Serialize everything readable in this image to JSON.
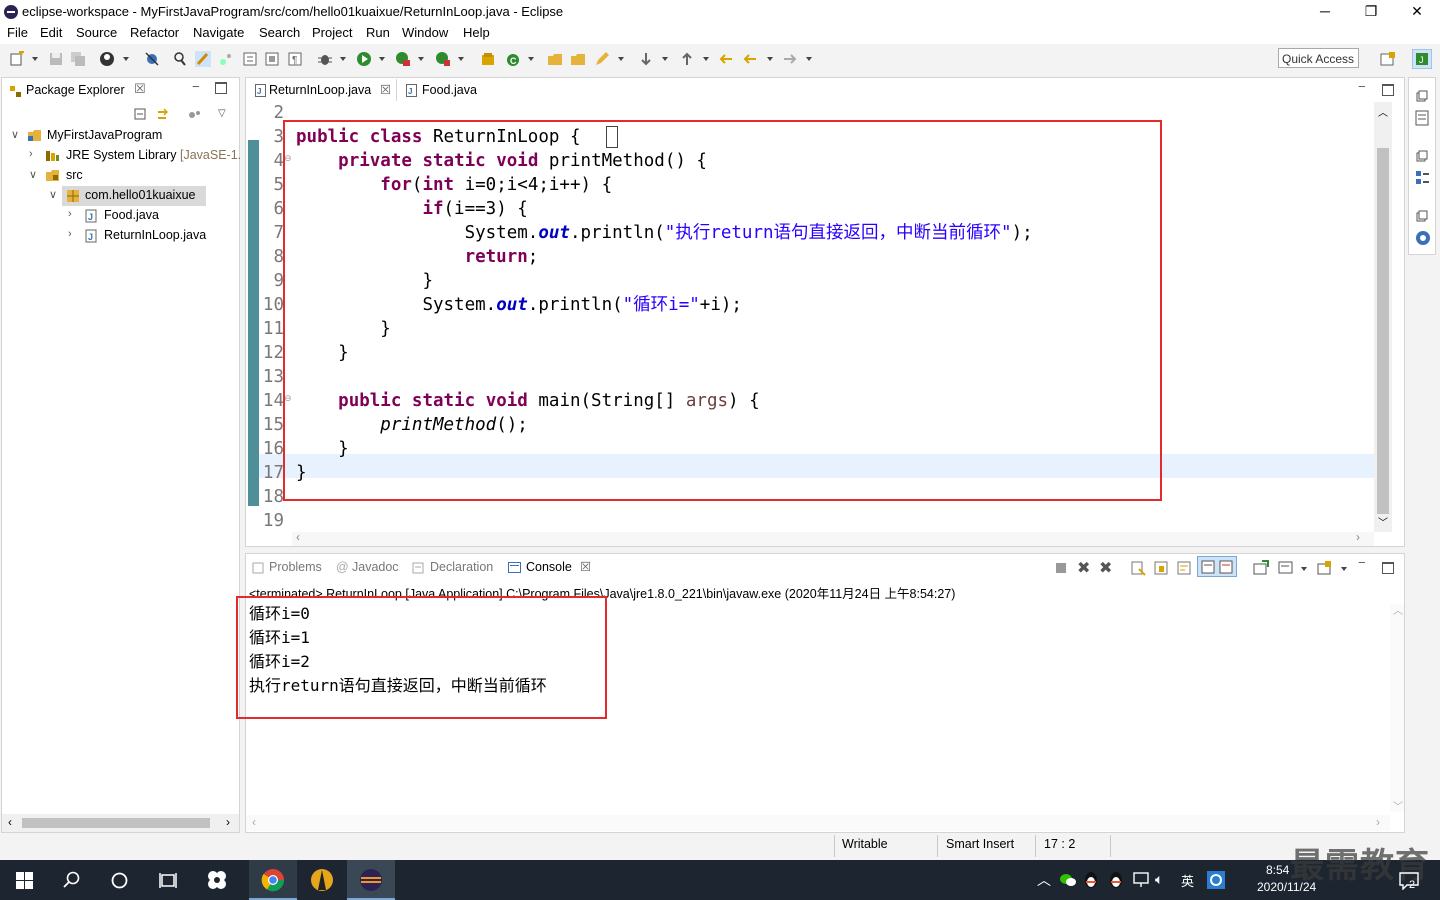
{
  "window": {
    "title": "eclipse-workspace - MyFirstJavaProgram/src/com/hello01kuaixue/ReturnInLoop.java - Eclipse",
    "minimize": "─",
    "restore": "❐",
    "close": "✕"
  },
  "menu": [
    "File",
    "Edit",
    "Source",
    "Refactor",
    "Navigate",
    "Search",
    "Project",
    "Run",
    "Window",
    "Help"
  ],
  "toolbar": {
    "quick_access": "Quick Access"
  },
  "package_explorer": {
    "title": "Package Explorer",
    "close": "☒",
    "tree": [
      {
        "label": "MyFirstJavaProgram",
        "extra": "",
        "level": 0,
        "expanded": true,
        "icon": "project-icon"
      },
      {
        "label": "JRE System Library",
        "extra": "[JavaSE-1.",
        "level": 1,
        "expanded": false,
        "icon": "library-icon"
      },
      {
        "label": "src",
        "extra": "",
        "level": 1,
        "expanded": true,
        "icon": "source-folder-icon"
      },
      {
        "label": "com.hello01kuaixue",
        "extra": "",
        "level": 2,
        "expanded": true,
        "icon": "package-icon",
        "selected": true
      },
      {
        "label": "Food.java",
        "extra": "",
        "level": 3,
        "expanded": false,
        "icon": "java-file-icon"
      },
      {
        "label": "ReturnInLoop.java",
        "extra": "",
        "level": 3,
        "expanded": false,
        "icon": "java-file-icon"
      }
    ]
  },
  "editor": {
    "tabs": [
      {
        "label": "ReturnInLoop.java",
        "active": true,
        "close": "☒"
      },
      {
        "label": "Food.java",
        "active": false
      }
    ],
    "line_numbers": [
      "2",
      "3",
      "4",
      "5",
      "6",
      "7",
      "8",
      "9",
      "10",
      "11",
      "12",
      "13",
      "14",
      "15",
      "16",
      "17",
      "18",
      "19"
    ],
    "code": [
      {
        "indent": "",
        "parts": []
      },
      {
        "indent": "",
        "parts": [
          [
            "kw",
            "public"
          ],
          [
            "",
            " "
          ],
          [
            "kw",
            "class"
          ],
          [
            "",
            " ReturnInLoop "
          ],
          [
            "",
            "{"
          ]
        ]
      },
      {
        "indent": "    ",
        "parts": [
          [
            "kw",
            "private"
          ],
          [
            "",
            " "
          ],
          [
            "kw",
            "static"
          ],
          [
            "",
            " "
          ],
          [
            "kw",
            "void"
          ],
          [
            "",
            " printMethod() {"
          ]
        ]
      },
      {
        "indent": "        ",
        "parts": [
          [
            "kw",
            "for"
          ],
          [
            "",
            "("
          ],
          [
            "kw",
            "int"
          ],
          [
            "",
            " i=0;i<4;i++) {"
          ]
        ]
      },
      {
        "indent": "            ",
        "parts": [
          [
            "kw",
            "if"
          ],
          [
            "",
            "(i==3) {"
          ]
        ]
      },
      {
        "indent": "                ",
        "parts": [
          [
            "",
            "System."
          ],
          [
            "fld",
            "out"
          ],
          [
            "",
            ".println("
          ],
          [
            "str",
            "\"执行return语句直接返回，中断当前循环\""
          ],
          [
            "",
            ");"
          ]
        ]
      },
      {
        "indent": "                ",
        "parts": [
          [
            "kw",
            "return"
          ],
          [
            "",
            ";"
          ]
        ]
      },
      {
        "indent": "            ",
        "parts": [
          [
            "",
            "}"
          ]
        ]
      },
      {
        "indent": "            ",
        "parts": [
          [
            "",
            "System."
          ],
          [
            "fld",
            "out"
          ],
          [
            "",
            ".println("
          ],
          [
            "str",
            "\"循环i=\""
          ],
          [
            "",
            "+i);"
          ]
        ]
      },
      {
        "indent": "        ",
        "parts": [
          [
            "",
            "}"
          ]
        ]
      },
      {
        "indent": "    ",
        "parts": [
          [
            "",
            "}"
          ]
        ]
      },
      {
        "indent": "",
        "parts": []
      },
      {
        "indent": "    ",
        "parts": [
          [
            "kw",
            "public"
          ],
          [
            "",
            " "
          ],
          [
            "kw",
            "static"
          ],
          [
            "",
            " "
          ],
          [
            "kw",
            "void"
          ],
          [
            "",
            " main(String[] "
          ],
          [
            "prm",
            "args"
          ],
          [
            "",
            ") {"
          ]
        ]
      },
      {
        "indent": "        ",
        "parts": [
          [
            "it",
            "printMethod"
          ],
          [
            "",
            "();"
          ]
        ]
      },
      {
        "indent": "    ",
        "parts": [
          [
            "",
            "}"
          ]
        ]
      },
      {
        "indent": "",
        "parts": [
          [
            "",
            "}"
          ]
        ]
      },
      {
        "indent": "",
        "parts": []
      },
      {
        "indent": "",
        "parts": []
      }
    ]
  },
  "console": {
    "tabs": [
      {
        "label": "Problems",
        "icon": "problems-icon"
      },
      {
        "label": "Javadoc",
        "icon": "javadoc-icon"
      },
      {
        "label": "Declaration",
        "icon": "declaration-icon"
      },
      {
        "label": "Console",
        "icon": "console-icon",
        "active": true
      }
    ],
    "status_line": "<terminated> ReturnInLoop [Java Application] C:\\Program Files\\Java\\jre1.8.0_221\\bin\\javaw.exe (2020年11月24日 上午8:54:27)",
    "output": [
      "循环i=0",
      "循环i=1",
      "循环i=2",
      "执行return语句直接返回，中断当前循环"
    ]
  },
  "statusbar": {
    "writable": "Writable",
    "insert_mode": "Smart Insert",
    "position": "17 : 2"
  },
  "taskbar": {
    "ime": "英",
    "time": "8:54",
    "date": "2020/11/24",
    "notifications": "2",
    "watermark": "最需教育"
  }
}
